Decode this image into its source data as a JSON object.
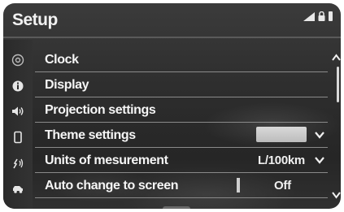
{
  "header": {
    "title": "Setup",
    "status_icons": [
      "signal-icon",
      "lock-icon",
      "battery-icon"
    ]
  },
  "sidebar": {
    "items": [
      {
        "icon": "settings-dial-icon",
        "active": true
      },
      {
        "icon": "info-icon",
        "active": false
      },
      {
        "icon": "speaker-icon",
        "active": false
      },
      {
        "icon": "phone-icon",
        "active": false
      },
      {
        "icon": "voice-icon",
        "active": false
      },
      {
        "icon": "car-icon",
        "active": false
      }
    ]
  },
  "menu": {
    "items": [
      {
        "label": "Clock"
      },
      {
        "label": "Display"
      },
      {
        "label": "Projection settings"
      },
      {
        "label": "Theme settings"
      },
      {
        "label": "Units of mesurement",
        "value": "L/100km"
      },
      {
        "label": "Auto change to screen",
        "value": "Off"
      }
    ]
  },
  "colors": {
    "background": "#2e2e2e",
    "text": "#f5f5f5",
    "divider": "#8a8a8a"
  }
}
